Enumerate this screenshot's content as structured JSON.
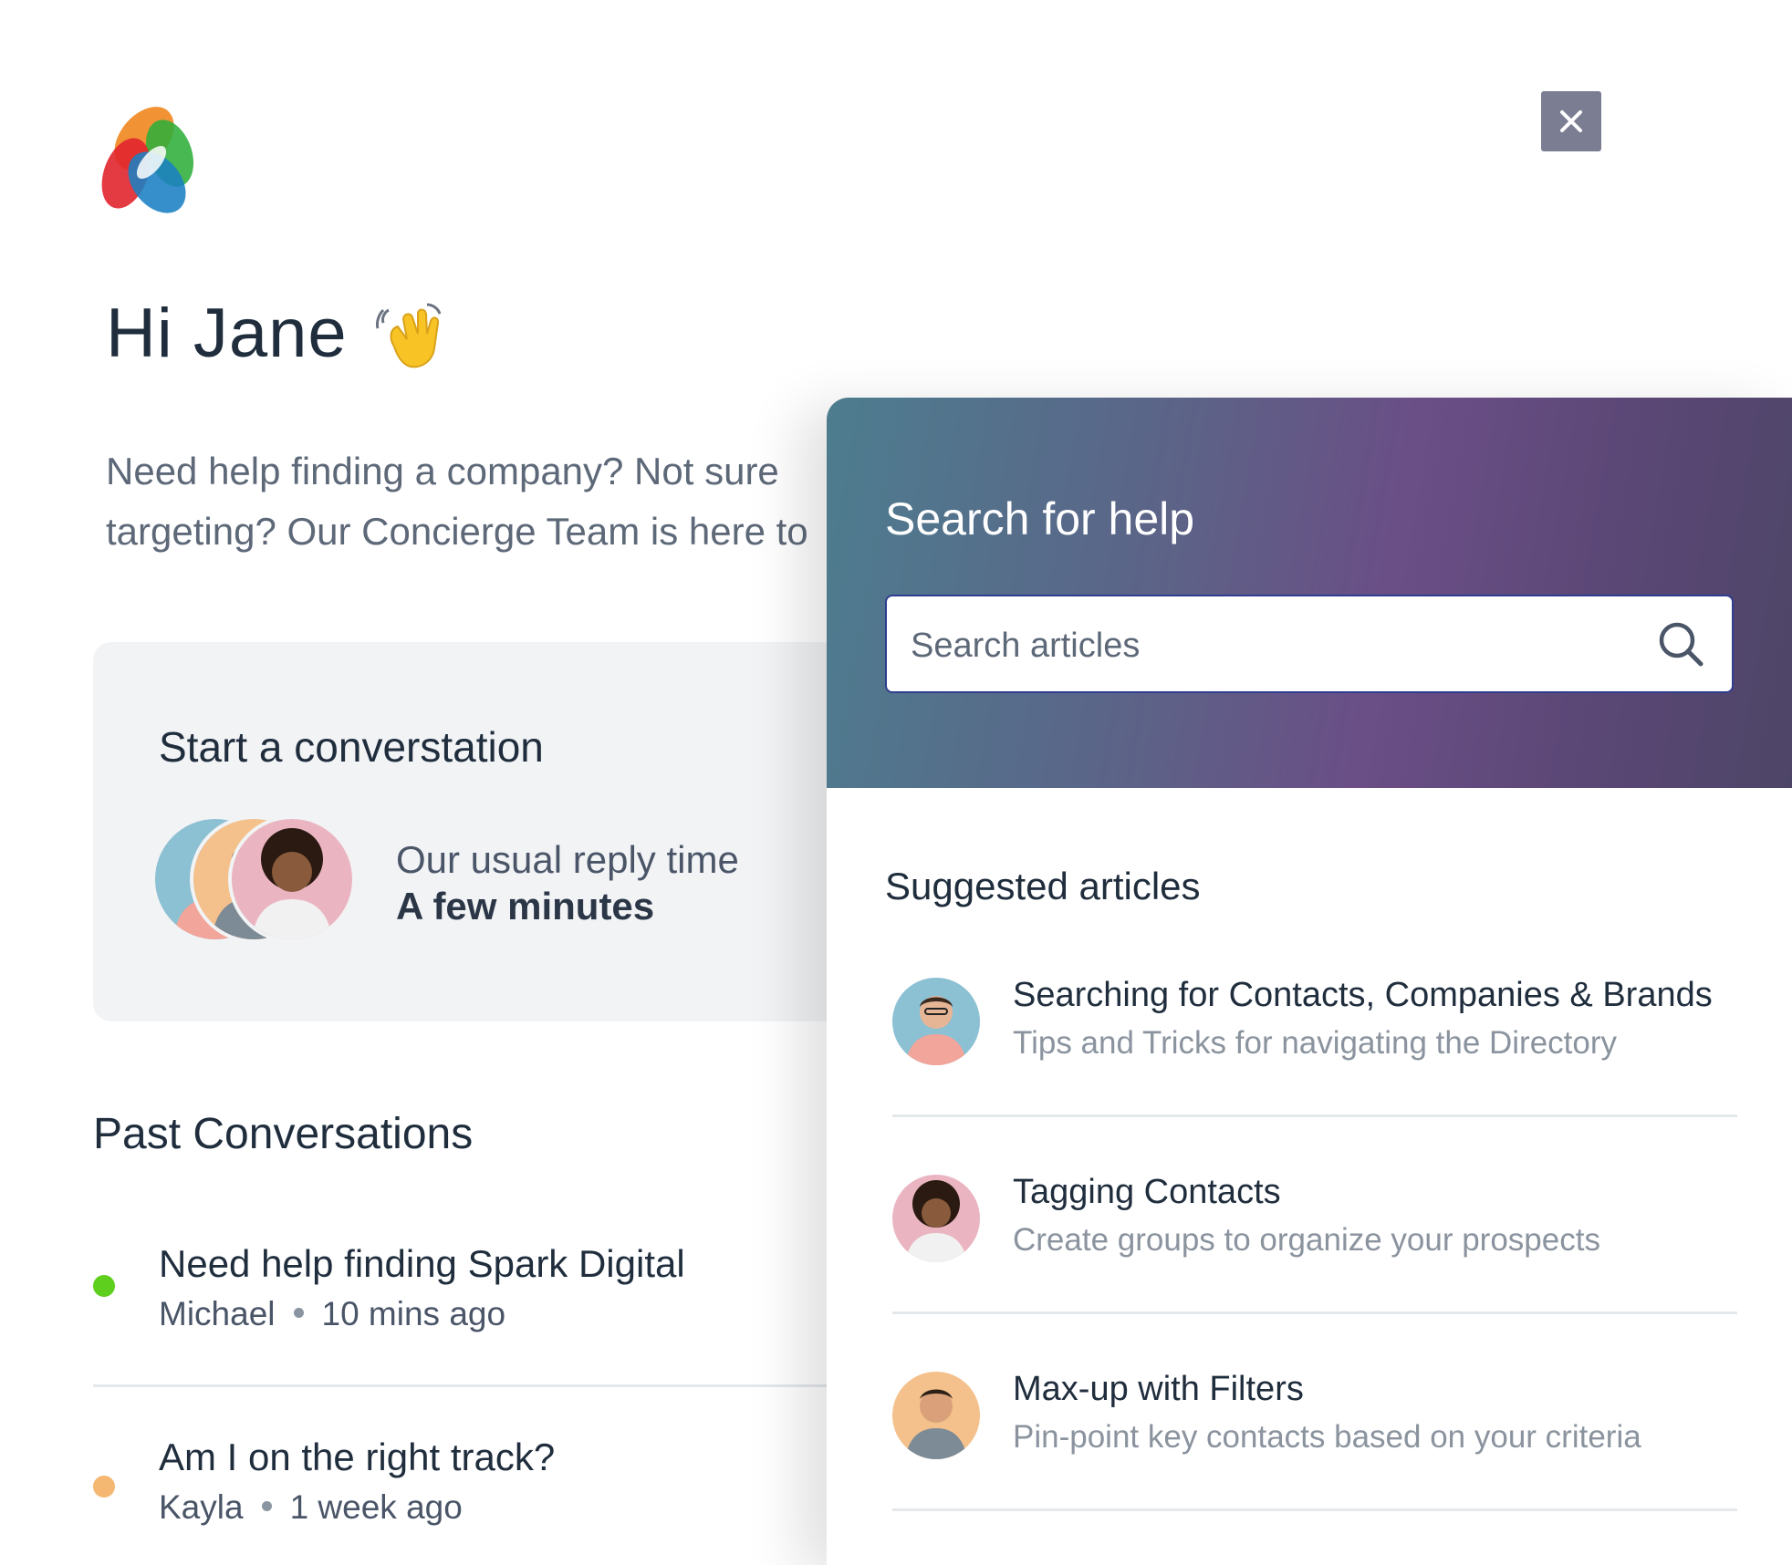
{
  "header": {
    "logo_icon": "multicolor-petal-logo",
    "close_icon": "close-icon"
  },
  "greeting": {
    "text": "Hi Jane",
    "emoji_icon": "waving-hand-icon"
  },
  "intro": {
    "line1": "Need help finding a company?  Not sure",
    "line2": "targeting? Our Concierge Team is here to"
  },
  "start_card": {
    "title": "Start a converstation",
    "reply_label": "Our usual reply time",
    "reply_value": "A few minutes"
  },
  "past": {
    "title": "Past Conversations",
    "items": [
      {
        "title": "Need help finding Spark Digital",
        "author": "Michael",
        "time": "10 mins ago",
        "status_color": "#5fcf1e"
      },
      {
        "title": "Am I on the right track?",
        "author": "Kayla",
        "time": "1 week ago",
        "status_color": "#f5b872"
      }
    ]
  },
  "help": {
    "title": "Search for help",
    "search_placeholder": "Search articles",
    "suggested_title": "Suggested articles",
    "articles": [
      {
        "title": "Searching for Contacts, Companies & Brands",
        "subtitle": "Tips and Tricks for navigating the Directory"
      },
      {
        "title": "Tagging Contacts",
        "subtitle": "Create groups to organize your prospects"
      },
      {
        "title": "Max-up with Filters",
        "subtitle": "Pin-point key contacts based on your criteria"
      }
    ]
  },
  "colors": {
    "close_button": "#7b7d93",
    "header_gradient": [
      "#4d7d8f",
      "#6a4e86",
      "#4d4567"
    ],
    "online": "#5fcf1e",
    "away": "#f5b872"
  }
}
